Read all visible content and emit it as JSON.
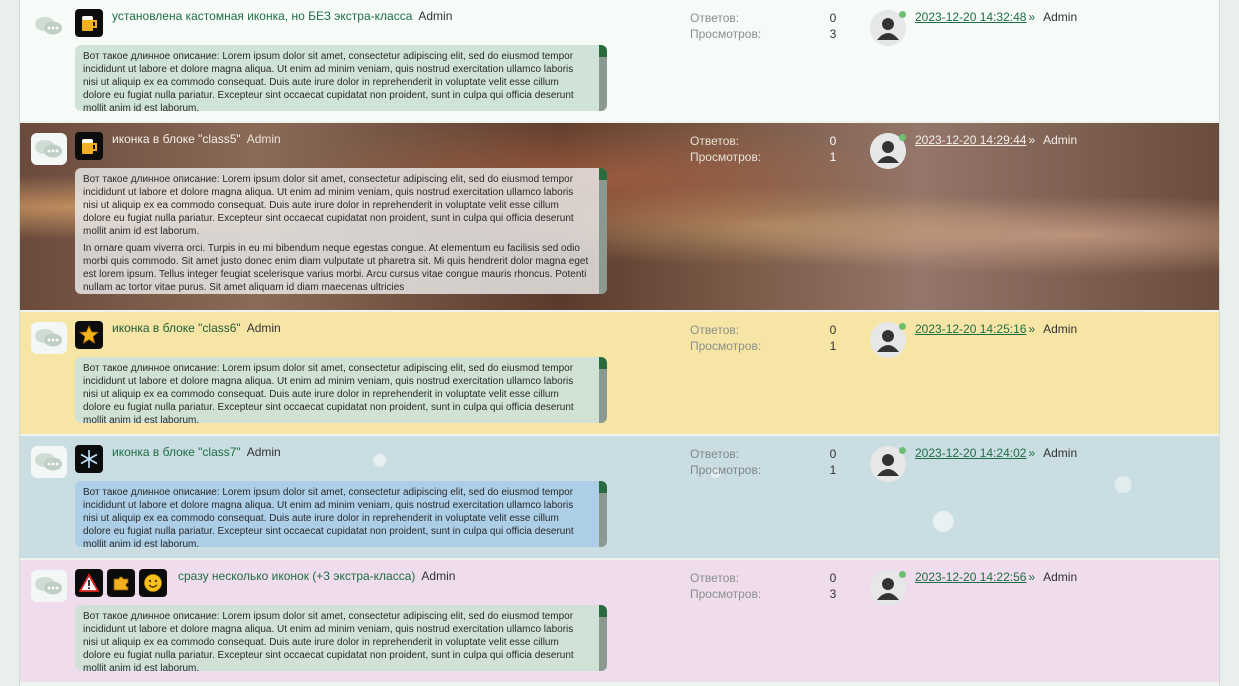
{
  "stats_labels": {
    "replies": "Ответов:",
    "views": "Просмотров:"
  },
  "description_text": "Вот такое длинное описание: Lorem ipsum dolor sit amet, consectetur adipiscing elit, sed do eiusmod tempor incididunt ut labore et dolore magna aliqua. Ut enim ad minim veniam, quis nostrud exercitation ullamco laboris nisi ut aliquip ex ea commodo consequat. Duis aute irure dolor in reprehenderit in voluptate velit esse cillum dolore eu fugiat nulla pariatur. Excepteur sint occaecat cupidatat non proident, sunt in culpa qui officia deserunt mollit anim id est laborum.",
  "description_extra": "In ornare quam viverra orci. Turpis in eu mi bibendum neque egestas congue. At elementum eu facilisis sed odio morbi quis commodo. Sit amet justo donec enim diam vulputate ut pharetra sit. Mi quis hendrerit dolor magna eget est lorem ipsum. Tellus integer feugiat scelerisque varius morbi. Arcu cursus vitae congue mauris rhoncus. Potenti nullam ac tortor vitae purus. Sit amet aliquam id diam maecenas ultricies",
  "topics": [
    {
      "title": "установлена кастомная иконка, но БЕЗ экстра-класса",
      "author": "Admin",
      "icons": [
        "beer-icon"
      ],
      "replies": "0",
      "views": "3",
      "last_date": "2023-12-20 14:32:48",
      "last_arrow": "»",
      "last_user": "Admin"
    },
    {
      "title": "иконка в блоке \"class5\"",
      "author": "Admin",
      "icons": [
        "beer-icon"
      ],
      "replies": "0",
      "views": "1",
      "last_date": "2023-12-20 14:29:44",
      "last_arrow": "»",
      "last_user": "Admin"
    },
    {
      "title": "иконка в блоке \"class6\"",
      "author": "Admin",
      "icons": [
        "star-icon"
      ],
      "replies": "0",
      "views": "1",
      "last_date": "2023-12-20 14:25:16",
      "last_arrow": "»",
      "last_user": "Admin"
    },
    {
      "title": "иконка в блоке \"class7\"",
      "author": "Admin",
      "icons": [
        "snowflake-icon"
      ],
      "replies": "0",
      "views": "1",
      "last_date": "2023-12-20 14:24:02",
      "last_arrow": "»",
      "last_user": "Admin"
    },
    {
      "title": "сразу несколько иконок (+3 экстра-класса)",
      "author": "Admin",
      "icons": [
        "warning-icon",
        "puzzle-icon",
        "smiley-icon"
      ],
      "replies": "0",
      "views": "3",
      "last_date": "2023-12-20 14:22:56",
      "last_arrow": "»",
      "last_user": "Admin"
    }
  ]
}
